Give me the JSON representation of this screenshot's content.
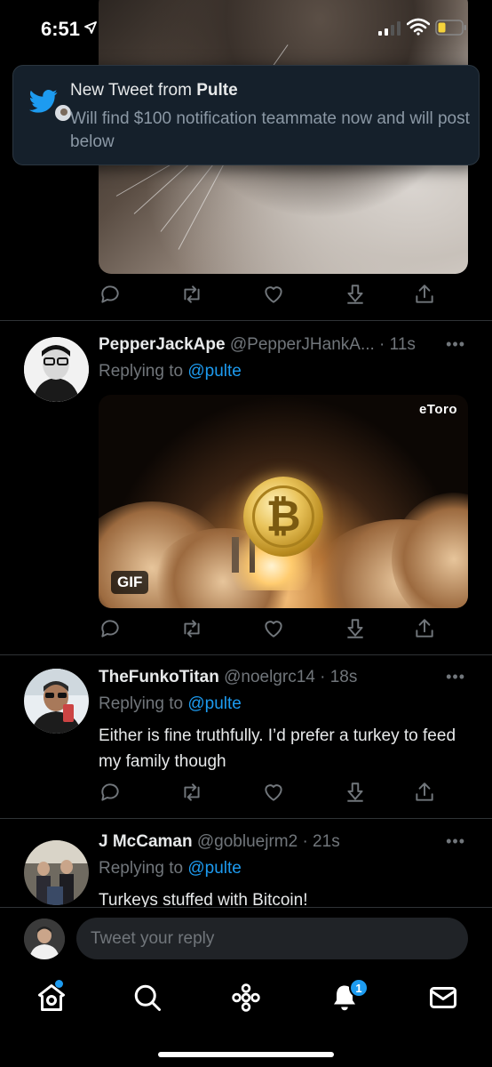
{
  "status": {
    "time": "6:51"
  },
  "notification": {
    "title_prefix": "New Tweet from ",
    "title_name": "Pulte",
    "body": "Will find $100 notification teammate now and will post below"
  },
  "tweets": [
    {
      "name": "PepperJackApe",
      "meta": "@PepperJHankA... · 11s",
      "replying_prefix": "Replying to ",
      "replying_to": "@pulte",
      "media": {
        "badge": "GIF",
        "watermark": "eToro"
      }
    },
    {
      "name": "TheFunkoTitan",
      "meta": "@noelgrc14 · 18s",
      "replying_prefix": "Replying to ",
      "replying_to": "@pulte",
      "text": "Either is fine truthfully. I’d prefer a turkey to feed my family though"
    },
    {
      "name": "J McCaman",
      "meta": "@gobluejrm2 · 21s",
      "replying_prefix": "Replying to ",
      "replying_to": "@pulte",
      "text": "Turkeys stuffed with Bitcoin!"
    }
  ],
  "more_label": "•••",
  "reply_bar": {
    "placeholder": "Tweet your reply"
  },
  "tab_bar": {
    "notifications_badge": "1"
  },
  "colors": {
    "accent": "#1d9bf0",
    "background": "#000000",
    "notification_bg": "#15202b"
  }
}
